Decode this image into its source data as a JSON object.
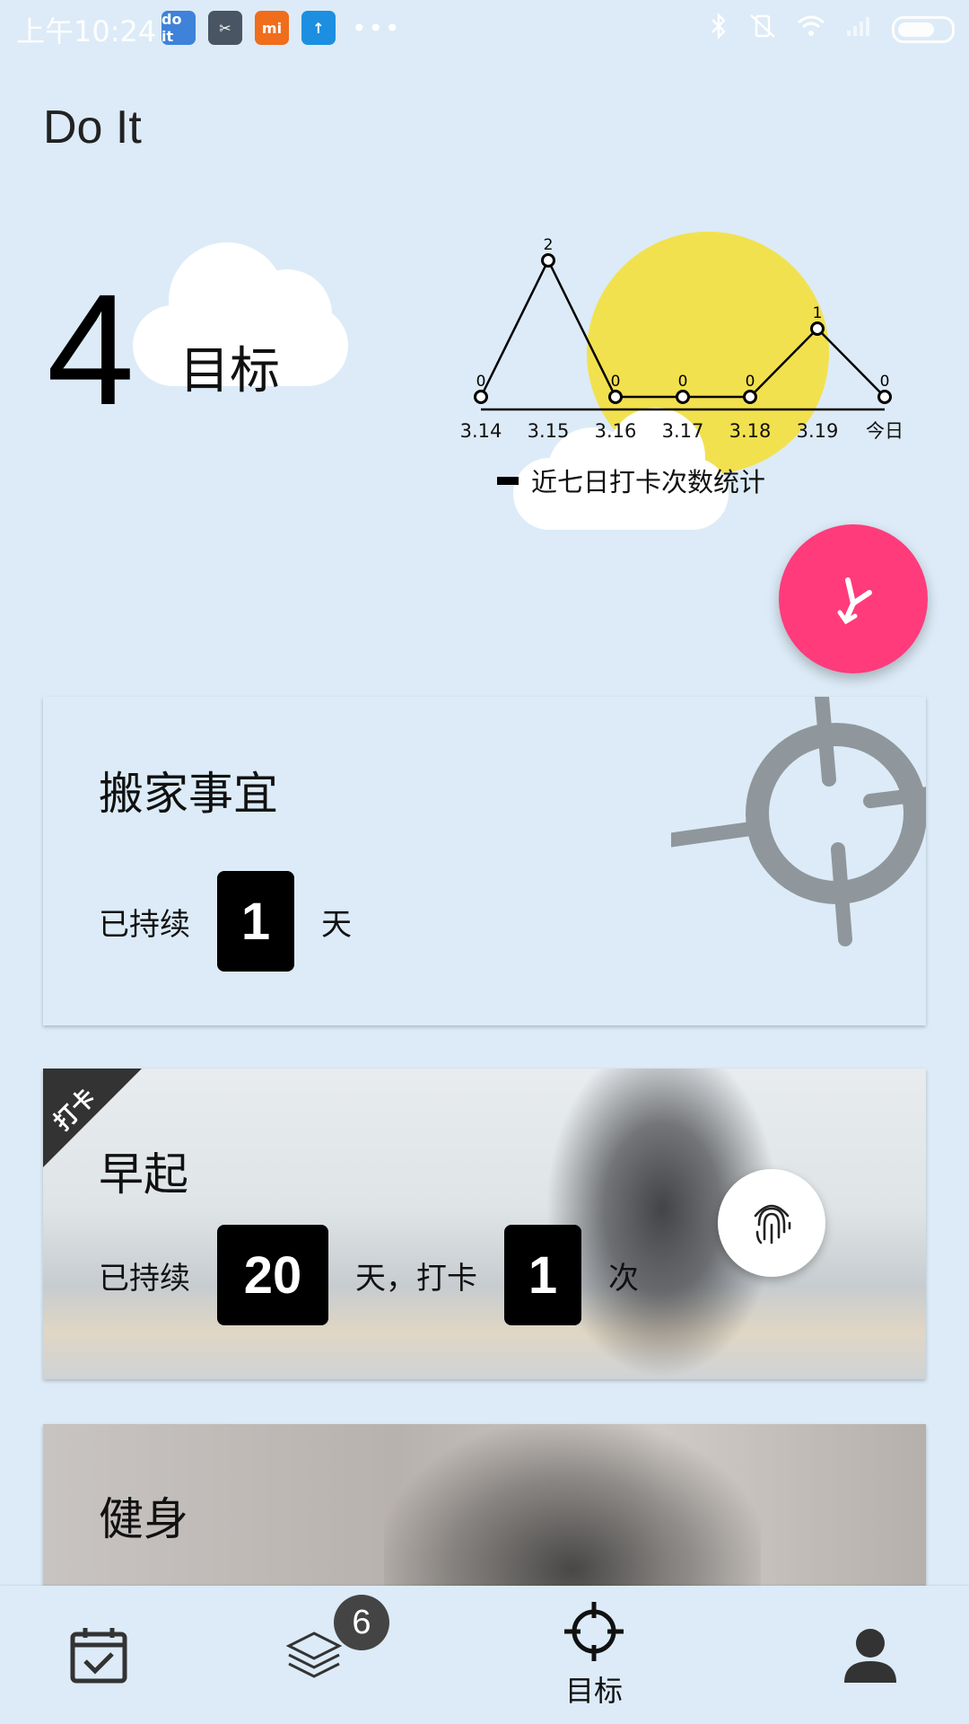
{
  "status_bar": {
    "time": "上午10:24",
    "apps": [
      "do it",
      "✂",
      "mi",
      "↑"
    ],
    "more": "•••"
  },
  "app": {
    "title": "Do It"
  },
  "summary": {
    "goal_count": "4",
    "goal_label": "目标"
  },
  "chart_data": {
    "type": "line",
    "categories": [
      "3.14",
      "3.15",
      "3.16",
      "3.17",
      "3.18",
      "3.19",
      "今日"
    ],
    "values": [
      0,
      2,
      0,
      0,
      0,
      1,
      0
    ],
    "data_labels": [
      "0",
      "2",
      "0",
      "0",
      "0",
      "1",
      "0"
    ],
    "legend": "近七日打卡次数统计",
    "ylim": [
      0,
      2
    ],
    "grid": false,
    "legend_position": "bottom"
  },
  "fab": {
    "icon": "branch-icon"
  },
  "cards": [
    {
      "title": "搬家事宜",
      "prefix": "已持续",
      "days": "1",
      "suffix": "天",
      "icon": "target-icon"
    },
    {
      "title": "早起",
      "ribbon": "打卡",
      "prefix": "已持续",
      "days": "20",
      "mid": "天，打卡",
      "count": "1",
      "suffix": "次",
      "icon": "fingerprint-icon"
    },
    {
      "title": "健身"
    }
  ],
  "nav": {
    "items": [
      {
        "icon": "calendar-check-icon",
        "label": ""
      },
      {
        "icon": "layers-icon",
        "label": "",
        "badge": "6"
      },
      {
        "icon": "target-icon",
        "label": "目标"
      },
      {
        "icon": "person-icon",
        "label": ""
      }
    ]
  },
  "colors": {
    "background": "#dcebf7",
    "fab": "#ff3b7c",
    "sun": "#f2e14e",
    "target_gray": "#8f979c"
  }
}
